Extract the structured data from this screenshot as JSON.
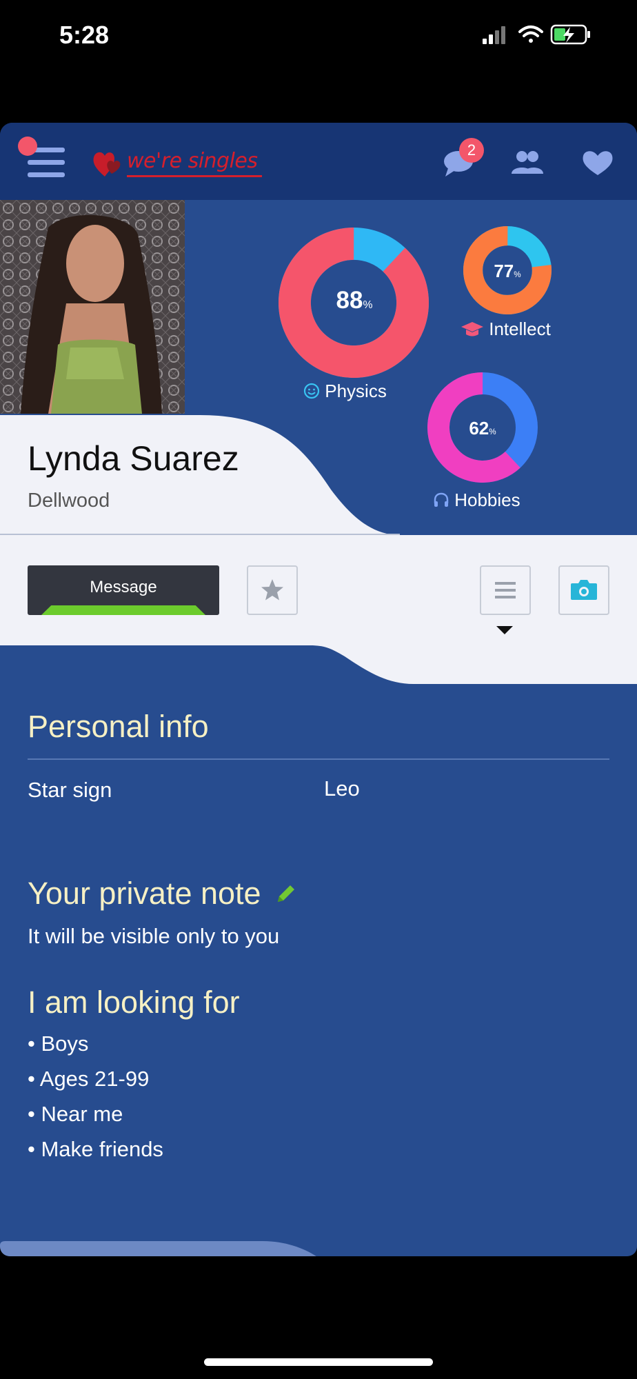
{
  "status_bar": {
    "time": "5:28"
  },
  "topbar": {
    "logo_text": "we're singles",
    "messages_badge": "2",
    "icons": [
      "menu-icon",
      "chat-bubble-icon",
      "users-icon",
      "heart-icon"
    ],
    "colors": {
      "bar": "#173574",
      "icons": "#8ea6e8",
      "badge": "#f3566a",
      "logo": "#d61f2c"
    }
  },
  "profile": {
    "name": "Lynda Suarez",
    "location": "Dellwood"
  },
  "scores": [
    {
      "label": "Physics",
      "percent": 88,
      "pct_text": "88",
      "unit": "%",
      "icon": "smile-icon",
      "main_color": "#f5556b",
      "rest_color": "#2fb8f5"
    },
    {
      "label": "Intellect",
      "percent": 77,
      "pct_text": "77",
      "unit": "%",
      "icon": "graduation-cap-icon",
      "main_color": "#fb7b3f",
      "rest_color": "#2ec5ef"
    },
    {
      "label": "Hobbies",
      "percent": 62,
      "pct_text": "62",
      "unit": "%",
      "icon": "headphones-icon",
      "main_color": "#f03fc1",
      "rest_color": "#3c7ff6"
    }
  ],
  "actions": {
    "message_label": "Message",
    "icons": [
      "star-icon",
      "list-icon",
      "camera-icon"
    ]
  },
  "personal_info": {
    "title": "Personal info",
    "rows": [
      {
        "key": "Star sign",
        "value": "Leo"
      }
    ]
  },
  "private_note": {
    "title": "Your private note",
    "subtitle": "It will be visible only to you"
  },
  "looking_for": {
    "title": "I am looking for",
    "items": [
      "Boys",
      "Ages 21-99",
      "Near me",
      "Make friends"
    ]
  }
}
